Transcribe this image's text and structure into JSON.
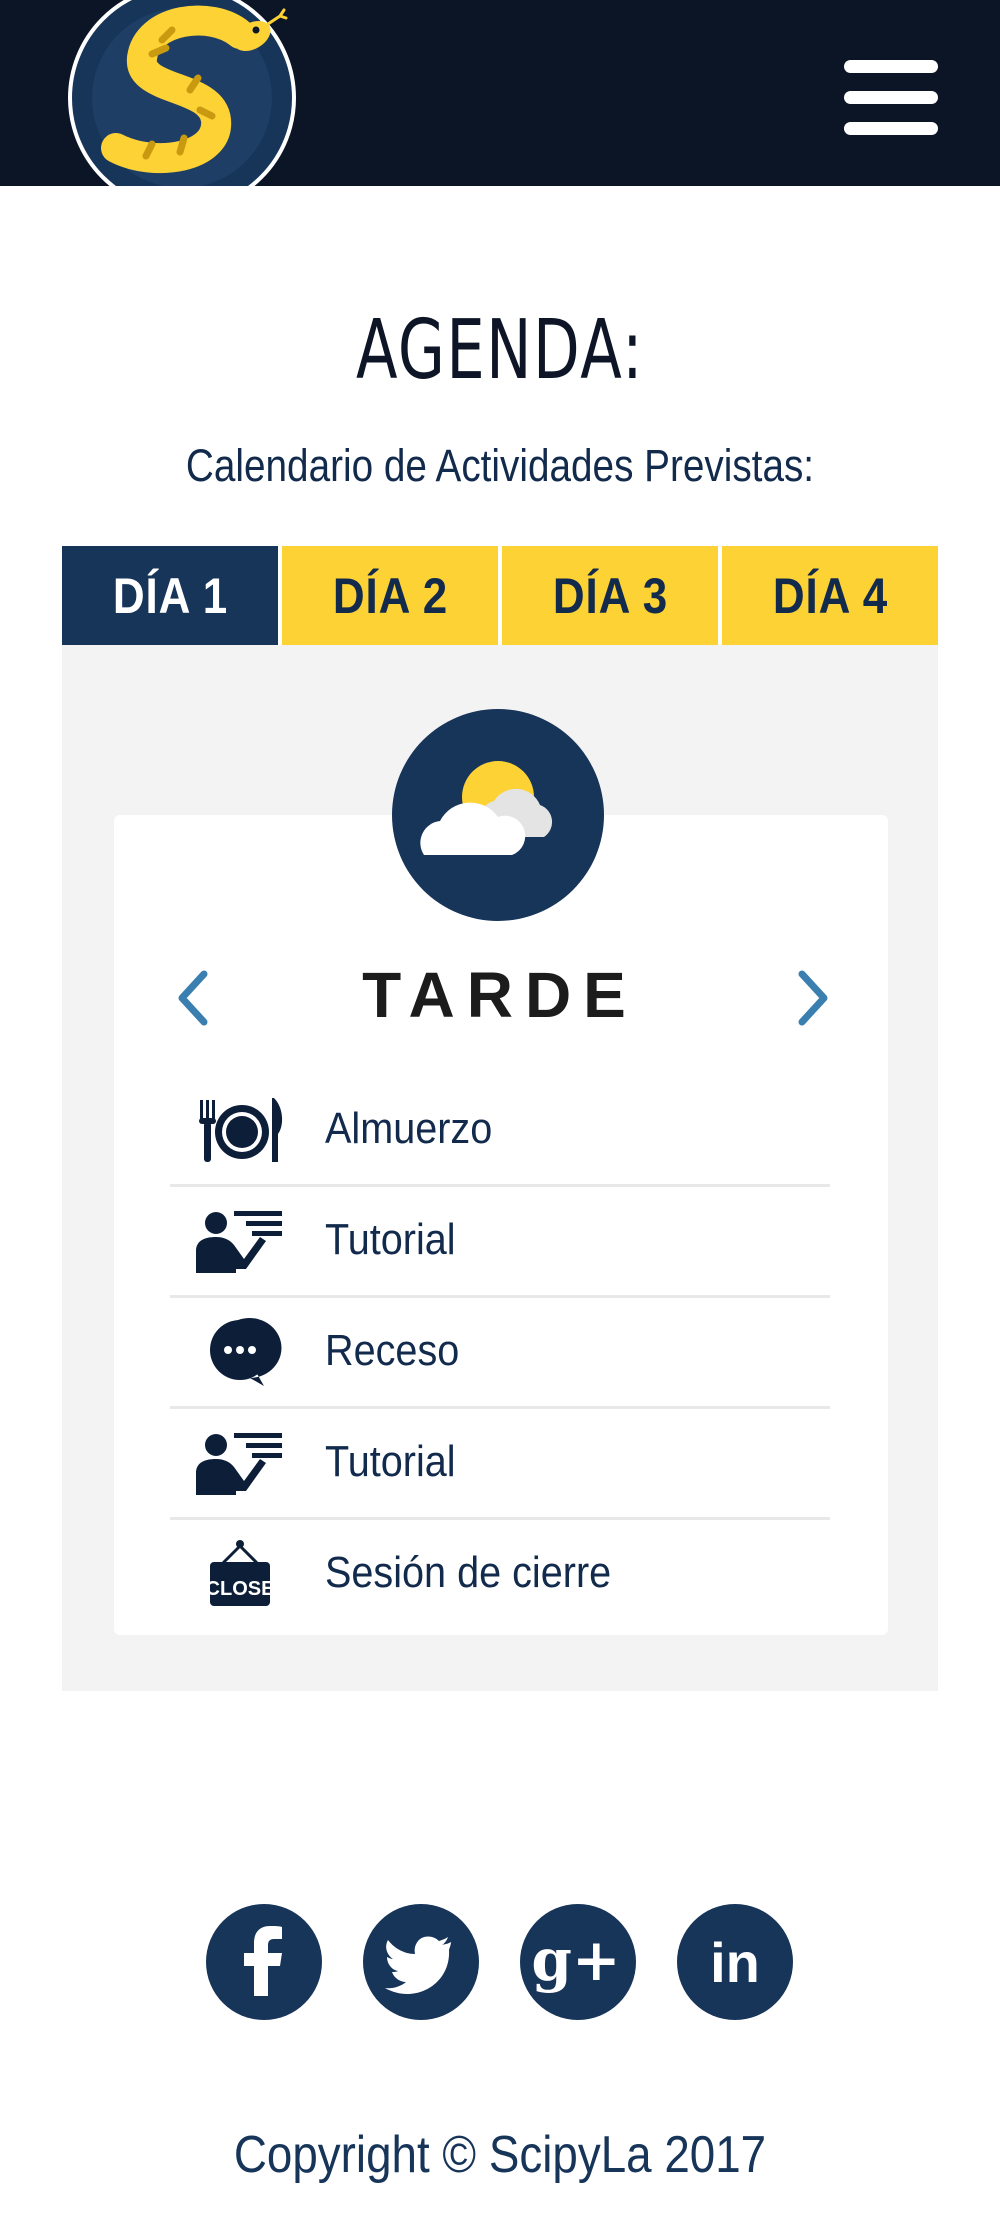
{
  "header": {
    "logo_icon": "scipyla-snake-logo",
    "menu_icon": "hamburger-menu-icon"
  },
  "agenda": {
    "title": "AGENDA:",
    "subtitle": "Calendario de Actividades Previstas:"
  },
  "tabs": [
    {
      "label": "DÍA 1",
      "active": true
    },
    {
      "label": "DÍA 2",
      "active": false
    },
    {
      "label": "DÍA 3",
      "active": false
    },
    {
      "label": "DÍA 4",
      "active": false
    }
  ],
  "session": {
    "icon": "sun-cloud-icon",
    "period": "TARDE",
    "items": [
      {
        "icon": "fork-plate-knife-icon",
        "label": "Almuerzo"
      },
      {
        "icon": "presenter-board-icon",
        "label": "Tutorial"
      },
      {
        "icon": "chat-bubble-icon",
        "label": "Receso"
      },
      {
        "icon": "presenter-board-icon",
        "label": "Tutorial"
      },
      {
        "icon": "close-sign-icon",
        "label": "Sesión de cierre",
        "sign_text": "CLOSE"
      }
    ]
  },
  "social": [
    {
      "icon": "facebook-icon"
    },
    {
      "icon": "twitter-icon"
    },
    {
      "icon": "google-plus-icon",
      "glyph": "g+"
    },
    {
      "icon": "linkedin-icon",
      "glyph": "in"
    }
  ],
  "footer": {
    "copyright": "Copyright © ScipyLa 2017"
  },
  "colors": {
    "navy": "#173459",
    "topbar": "#0b1526",
    "yellow": "#fdd235",
    "panel": "#f3f3f3",
    "arrow": "#3a7fb0"
  }
}
